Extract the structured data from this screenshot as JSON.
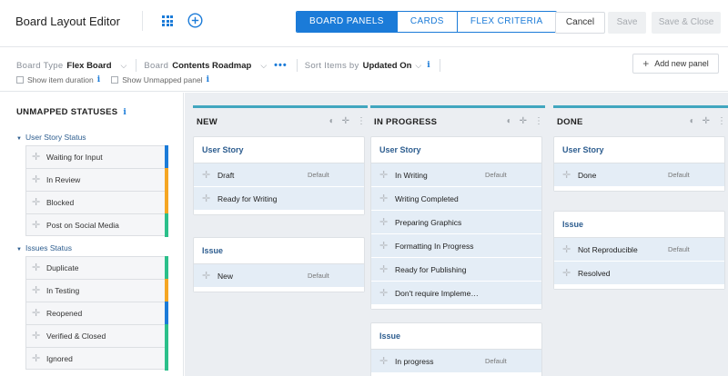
{
  "header": {
    "title": "Board Layout Editor",
    "tabs": [
      "BOARD PANELS",
      "CARDS",
      "FLEX CRITERIA"
    ],
    "active_tab": "BOARD PANELS",
    "cancel_label": "Cancel",
    "save_label": "Save",
    "save_close_label": "Save & Close",
    "icons": [
      "grid-icon",
      "plus-circle-icon"
    ]
  },
  "toolbar": {
    "board_type_label": "Board Type",
    "board_type_value": "Flex Board",
    "board_label": "Board",
    "board_value": "Contents Roadmap",
    "sort_label": "Sort Items by",
    "sort_value": "Updated On",
    "show_item_duration": "Show item duration",
    "show_unmapped_panel": "Show Unmapped panel",
    "add_panel_label": "Add new panel"
  },
  "sidebar": {
    "title": "UNMAPPED STATUSES",
    "groups": [
      {
        "title": "User Story Status",
        "items": [
          {
            "label": "Waiting for Input",
            "color": "#1b7bd8"
          },
          {
            "label": "In Review",
            "color": "#f5a623"
          },
          {
            "label": "Blocked",
            "color": "#f5a623"
          },
          {
            "label": "Post on Social Media",
            "color": "#2bbf8a"
          }
        ]
      },
      {
        "title": "Issues Status",
        "items": [
          {
            "label": "Duplicate",
            "color": "#2bbf8a"
          },
          {
            "label": "In Testing",
            "color": "#f5a623"
          },
          {
            "label": "Reopened",
            "color": "#1b7bd8"
          },
          {
            "label": "Verified & Closed",
            "color": "#2bbf8a"
          },
          {
            "label": "Ignored",
            "color": "#2bbf8a"
          }
        ]
      }
    ]
  },
  "columns": [
    {
      "title": "NEW",
      "panels": [
        {
          "title": "User Story",
          "items": [
            {
              "label": "Draft",
              "default": "Default"
            },
            {
              "label": "Ready for Writing",
              "default": ""
            }
          ]
        },
        {
          "title": "Issue",
          "items": [
            {
              "label": "New",
              "default": "Default"
            }
          ]
        }
      ]
    },
    {
      "title": "IN PROGRESS",
      "panels": [
        {
          "title": "User Story",
          "items": [
            {
              "label": "In Writing",
              "default": "Default"
            },
            {
              "label": "Writing Completed",
              "default": ""
            },
            {
              "label": "Preparing Graphics",
              "default": ""
            },
            {
              "label": "Formatting In Progress",
              "default": ""
            },
            {
              "label": "Ready for Publishing",
              "default": ""
            },
            {
              "label": "Don't require Impleme…",
              "default": ""
            }
          ]
        },
        {
          "title": "Issue",
          "items": [
            {
              "label": "In progress",
              "default": "Default"
            }
          ]
        }
      ]
    },
    {
      "title": "DONE",
      "panels": [
        {
          "title": "User Story",
          "items": [
            {
              "label": "Done",
              "default": "Default"
            }
          ]
        },
        {
          "title": "Issue",
          "items": [
            {
              "label": "Not Reproducible",
              "default": "Default"
            },
            {
              "label": "Resolved",
              "default": ""
            }
          ]
        }
      ]
    }
  ],
  "colors": {
    "accent": "#1b7bd8",
    "column_accent": "#41a6bf",
    "item_bg": "#e4edf6"
  }
}
